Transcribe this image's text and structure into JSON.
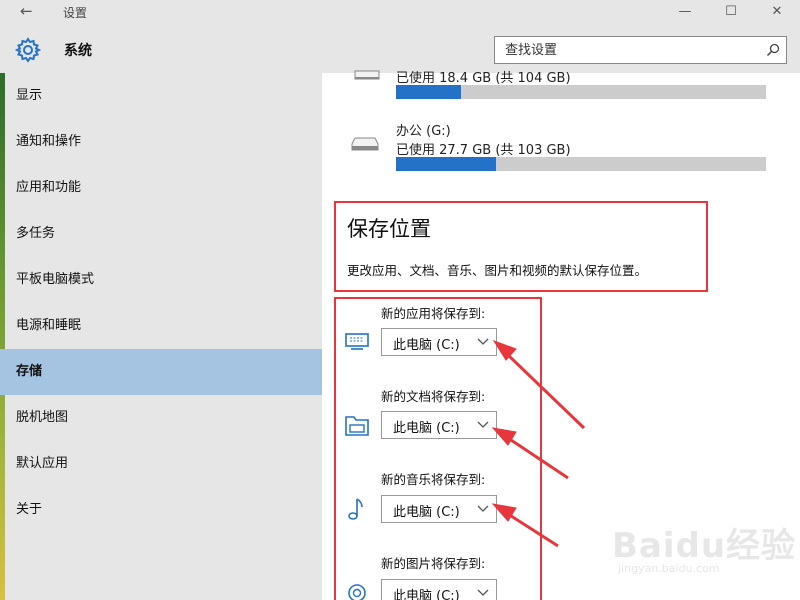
{
  "window": {
    "title": "设置",
    "back_glyph": "←",
    "minimize_glyph": "—",
    "maximize_glyph": "☐",
    "close_glyph": "✕"
  },
  "header": {
    "title": "系统",
    "search_placeholder": "查找设置"
  },
  "sidebar": {
    "items": [
      {
        "label": "显示"
      },
      {
        "label": "通知和操作"
      },
      {
        "label": "应用和功能"
      },
      {
        "label": "多任务"
      },
      {
        "label": "平板电脑模式"
      },
      {
        "label": "电源和睡眠"
      },
      {
        "label": "存储",
        "selected": true
      },
      {
        "label": "脱机地图"
      },
      {
        "label": "默认应用"
      },
      {
        "label": "关于"
      }
    ]
  },
  "drives": [
    {
      "name": "",
      "usage": "已使用 18.4 GB (共 104 GB)",
      "used_fraction": 0.177
    },
    {
      "name": "办公 (G:)",
      "usage": "已使用 27.7 GB (共 103 GB)",
      "used_fraction": 0.269
    }
  ],
  "save_locations": {
    "title": "保存位置",
    "description": "更改应用、文档、音乐、图片和视频的默认保存位置。",
    "items": [
      {
        "label": "新的应用将保存到:",
        "value": "此电脑 (C:)",
        "icon": "monitor-icon"
      },
      {
        "label": "新的文档将保存到:",
        "value": "此电脑 (C:)",
        "icon": "documents-icon"
      },
      {
        "label": "新的音乐将保存到:",
        "value": "此电脑 (C:)",
        "icon": "music-note-icon"
      },
      {
        "label": "新的图片将保存到:",
        "value": "此电脑 (C:)",
        "icon": "camera-icon"
      }
    ]
  },
  "colors": {
    "accent": "#2472c8",
    "selected_nav": "#a5c4e2",
    "annotation": "#e8373c"
  },
  "watermark": {
    "logo": "Baidu经验",
    "url": "jingyan.baidu.com"
  }
}
